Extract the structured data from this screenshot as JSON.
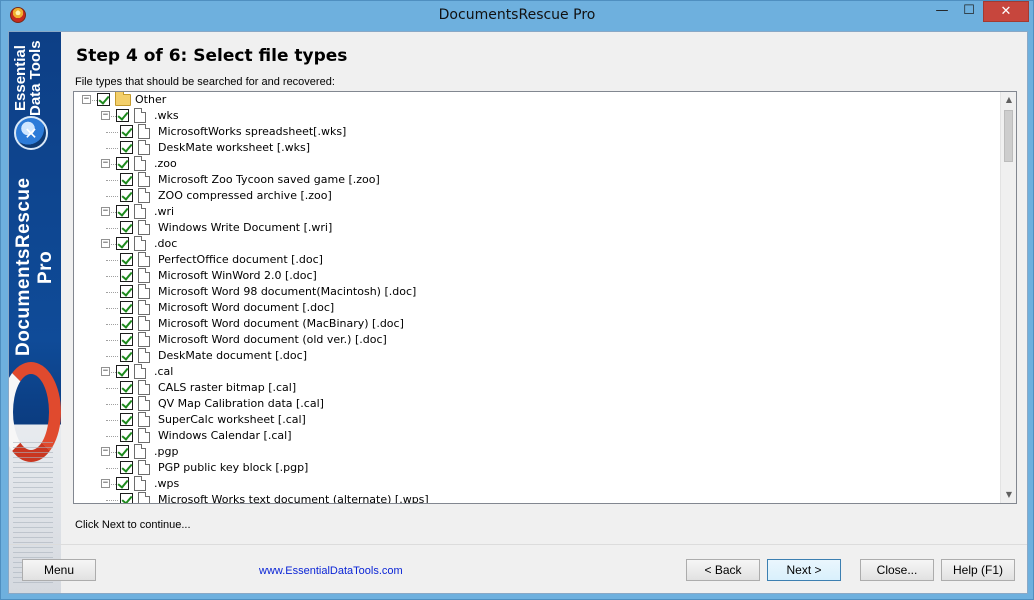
{
  "window": {
    "title": "DocumentsRescue Pro",
    "minimize_glyph": "—",
    "maximize_glyph": "☐",
    "close_glyph": "✕"
  },
  "sidebar": {
    "brand": "Essential Data Tools",
    "product": "DocumentsRescue Pro"
  },
  "header": {
    "step_title": "Step 4 of 6: Select file types",
    "subtitle": "File types that should be searched for and recovered:"
  },
  "tree": {
    "root": {
      "label": "Other",
      "checked": true,
      "expanded": true
    },
    "groups": [
      {
        "label": ".wks",
        "checked": true,
        "expanded": true,
        "items": [
          "MicrosoftWorks spreadsheet[.wks]",
          "DeskMate worksheet [.wks]"
        ]
      },
      {
        "label": ".zoo",
        "checked": true,
        "expanded": true,
        "items": [
          "Microsoft Zoo Tycoon saved game [.zoo]",
          "ZOO compressed archive [.zoo]"
        ]
      },
      {
        "label": ".wri",
        "checked": true,
        "expanded": true,
        "items": [
          "Windows Write Document [.wri]"
        ]
      },
      {
        "label": ".doc",
        "checked": true,
        "expanded": true,
        "items": [
          "PerfectOffice document [.doc]",
          "Microsoft WinWord 2.0 [.doc]",
          "Microsoft Word 98 document(Macintosh) [.doc]",
          "Microsoft Word document [.doc]",
          "Microsoft Word document (MacBinary) [.doc]",
          "Microsoft Word document (old ver.) [.doc]",
          "DeskMate document [.doc]"
        ]
      },
      {
        "label": ".cal",
        "checked": true,
        "expanded": true,
        "items": [
          "CALS raster bitmap [.cal]",
          "QV Map Calibration data [.cal]",
          "SuperCalc worksheet [.cal]",
          "Windows Calendar [.cal]"
        ]
      },
      {
        "label": ".pgp",
        "checked": true,
        "expanded": true,
        "items": [
          "PGP public key block [.pgp]"
        ]
      },
      {
        "label": ".wps",
        "checked": true,
        "expanded": true,
        "items": [
          "Microsoft Works text document (alternate) [.wps]"
        ]
      }
    ]
  },
  "hint": "Click Next to continue...",
  "footer": {
    "menu": "Menu",
    "website": "www.EssentialDataTools.com",
    "back": "< Back",
    "next": "Next >",
    "close": "Close...",
    "help": "Help (F1)"
  },
  "colors": {
    "titlebar": "#6eb0de",
    "close_button": "#c7463d",
    "link": "#0b25d6",
    "check": "#1d8a1d"
  }
}
